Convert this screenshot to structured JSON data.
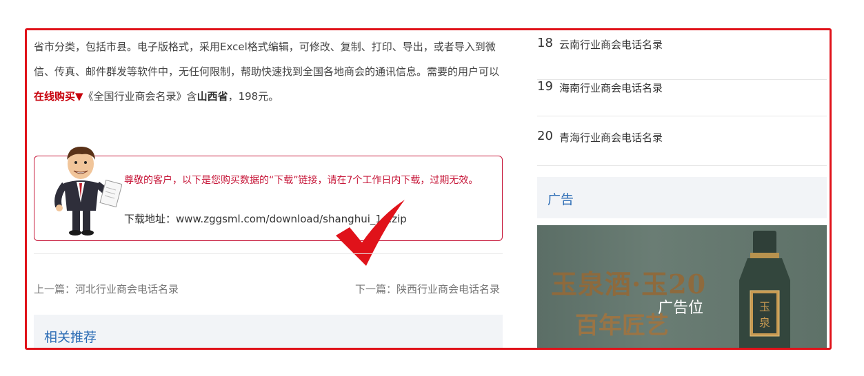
{
  "article": {
    "intro_part1": "省市分类，包括市县。电子版格式，采用Excel格式编辑，可修改、复制、打印、导出，或者导入到微信、传真、邮件群发等软件中，无任何限制，帮助快速找到全国各地商会的通讯信息。需要的用户可以",
    "buy_link": "在线购买▼",
    "intro_part2": "《全国行业商会名录》含",
    "province": "山西省",
    "intro_part3": "，198元。"
  },
  "download": {
    "notice": "尊敬的客户，以下是您购买数据的“下载”链接，请在7个工作日内下载，过期无效。",
    "address": "下载地址：www.zggsml.com/download/shanghui_14.zip"
  },
  "pager": {
    "prev": "上一篇：河北行业商会电话名录",
    "next": "下一篇：陕西行业商会电话名录"
  },
  "related": {
    "title": "相关推荐"
  },
  "sidebar": {
    "ranking": [
      {
        "num": "18",
        "title": "云南行业商会电话名录"
      },
      {
        "num": "19",
        "title": "海南行业商会电话名录"
      },
      {
        "num": "20",
        "title": "青海行业商会电话名录"
      }
    ],
    "ad_title": "广告",
    "ad_label": "广告位",
    "ad_brand": "玉泉酒·玉20",
    "ad_slogan": "百年匠艺",
    "ad_bottle_label": "玉泉"
  },
  "colors": {
    "highlight_border": "#e0121a",
    "accent_red": "#c7183a",
    "link_blue": "#2d6db5"
  }
}
